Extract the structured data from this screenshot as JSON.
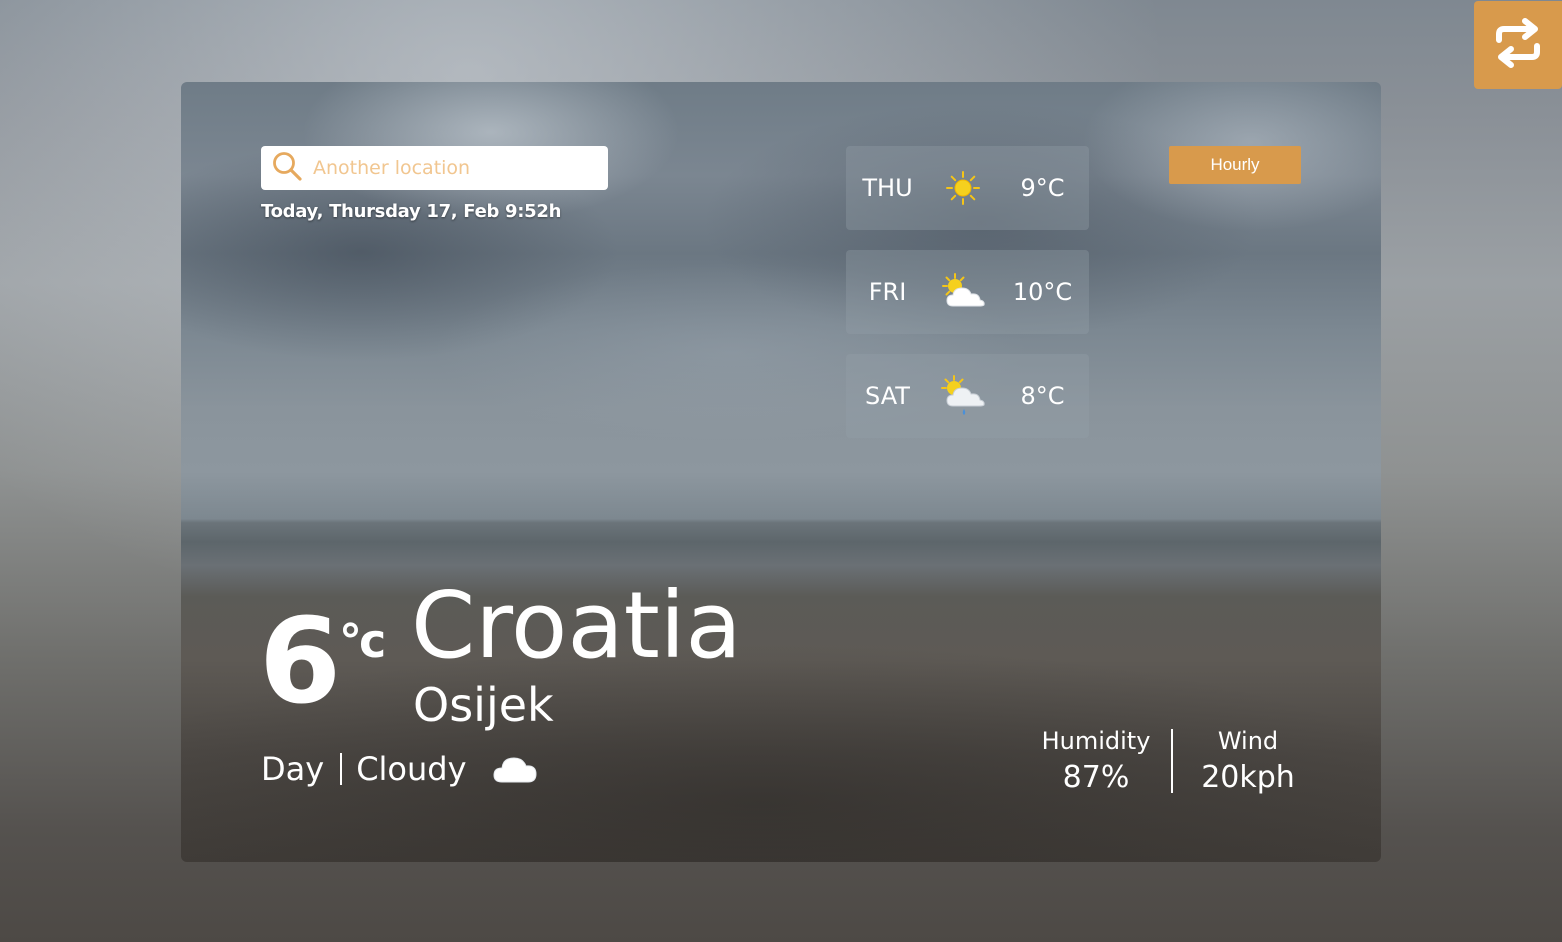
{
  "search": {
    "placeholder": "Another location"
  },
  "date_line": "Today, Thursday 17, Feb 9:52h",
  "hourly_label": "Hourly",
  "forecast": [
    {
      "day": "THU",
      "icon": "sun-icon",
      "temp": "9°C"
    },
    {
      "day": "FRI",
      "icon": "partly-cloudy-icon",
      "temp": "10°C"
    },
    {
      "day": "SAT",
      "icon": "partly-cloudy-rain-icon",
      "temp": "8°C"
    }
  ],
  "current": {
    "temp": "6",
    "unit": "°c",
    "country": "Croatia",
    "city": "Osijek",
    "period": "Day",
    "condition": "Cloudy",
    "condition_icon": "cloud-icon"
  },
  "stats": {
    "humidity_label": "Humidity",
    "humidity_value": "87%",
    "wind_label": "Wind",
    "wind_value": "20kph"
  },
  "colors": {
    "accent": "#d89a4c",
    "placeholder": "#f1c690",
    "sun": "#f5c518",
    "rain": "#4a90d9"
  }
}
